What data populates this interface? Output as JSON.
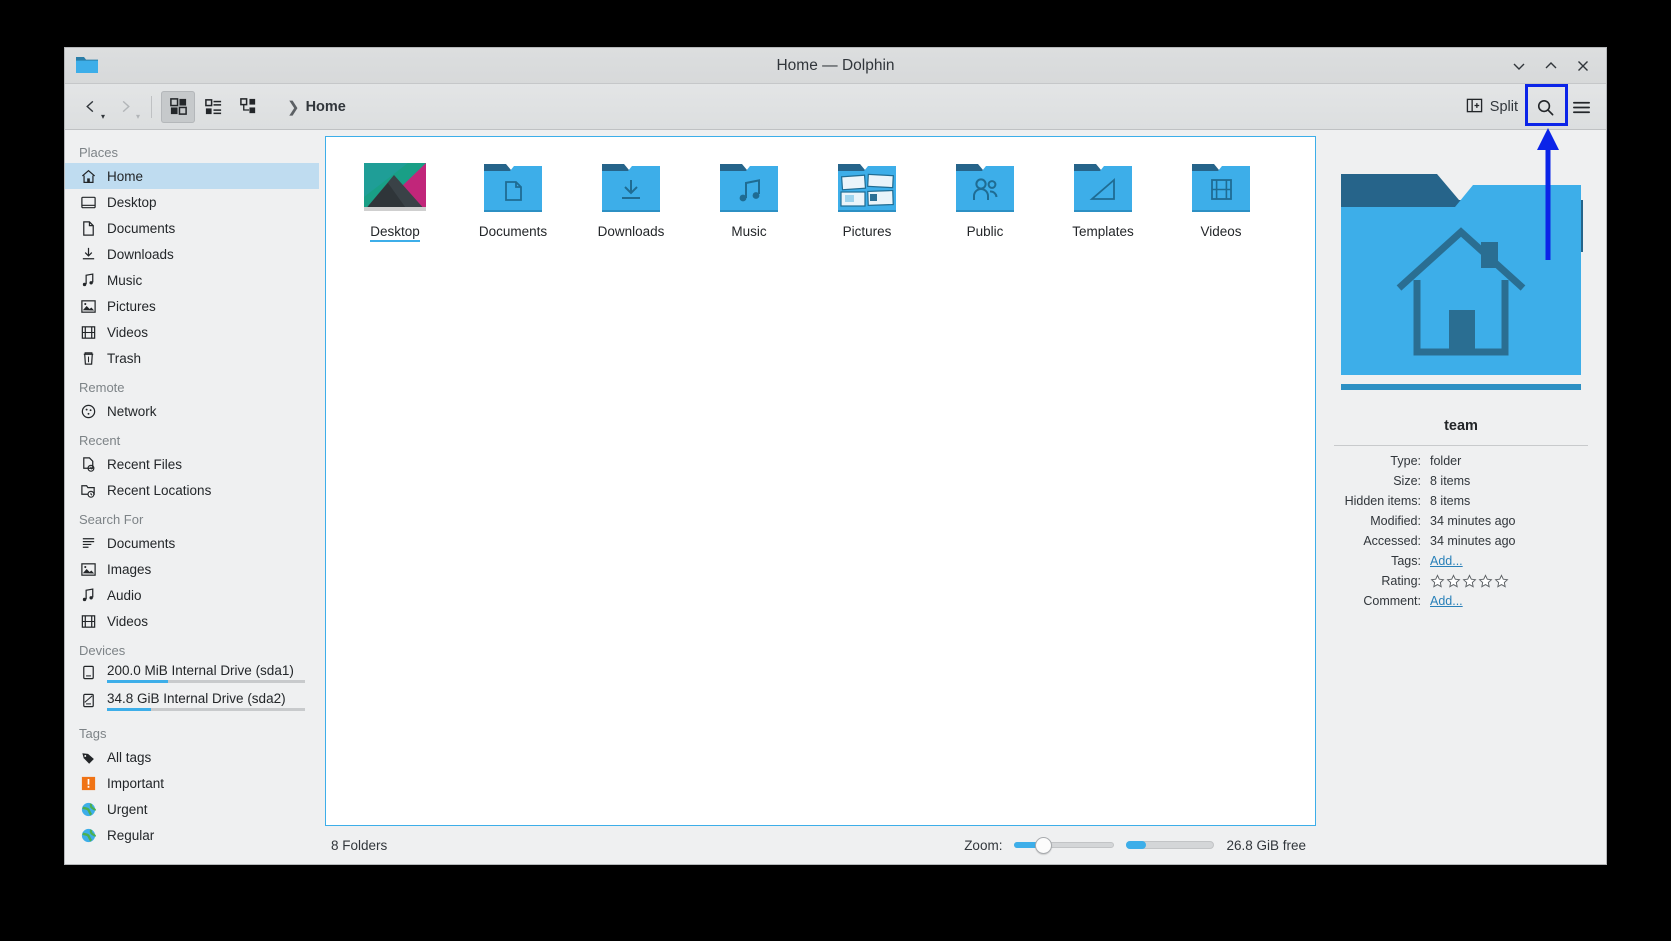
{
  "window": {
    "title": "Home — Dolphin",
    "app_icon": "folder-icon"
  },
  "titlebar_buttons": [
    {
      "name": "minimize-button",
      "glyph": "minimize-icon"
    },
    {
      "name": "maximize-button",
      "glyph": "maximize-icon"
    },
    {
      "name": "close-button",
      "glyph": "close-icon"
    }
  ],
  "toolbar": {
    "back_label": "Back",
    "forward_label": "Forward",
    "view_icons_label": "Icons",
    "view_compact_label": "Compact",
    "view_details_label": "Details",
    "split_label": "Split",
    "search_label": "Search",
    "menu_label": "Control"
  },
  "breadcrumb": {
    "separator": "❯",
    "crumb": "Home"
  },
  "sidebar": {
    "groups": [
      {
        "title": "Places",
        "items": [
          {
            "label": "Home",
            "icon": "home-icon",
            "selected": true
          },
          {
            "label": "Desktop",
            "icon": "desktop-icon",
            "selected": false
          },
          {
            "label": "Documents",
            "icon": "document-icon",
            "selected": false
          },
          {
            "label": "Downloads",
            "icon": "download-icon",
            "selected": false
          },
          {
            "label": "Music",
            "icon": "music-icon",
            "selected": false
          },
          {
            "label": "Pictures",
            "icon": "picture-icon",
            "selected": false
          },
          {
            "label": "Videos",
            "icon": "video-icon",
            "selected": false
          },
          {
            "label": "Trash",
            "icon": "trash-icon",
            "selected": false
          }
        ]
      },
      {
        "title": "Remote",
        "items": [
          {
            "label": "Network",
            "icon": "network-icon",
            "selected": false
          }
        ]
      },
      {
        "title": "Recent",
        "items": [
          {
            "label": "Recent Files",
            "icon": "recent-file-icon",
            "selected": false
          },
          {
            "label": "Recent Locations",
            "icon": "recent-folder-icon",
            "selected": false
          }
        ]
      },
      {
        "title": "Search For",
        "items": [
          {
            "label": "Documents",
            "icon": "search-documents-icon",
            "selected": false
          },
          {
            "label": "Images",
            "icon": "search-images-icon",
            "selected": false
          },
          {
            "label": "Audio",
            "icon": "search-audio-icon",
            "selected": false
          },
          {
            "label": "Videos",
            "icon": "search-videos-icon",
            "selected": false
          }
        ]
      },
      {
        "title": "Devices",
        "items": [
          {
            "label": "200.0 MiB Internal Drive (sda1)",
            "icon": "drive-icon",
            "selected": false,
            "usage_percent": 31
          },
          {
            "label": "34.8 GiB Internal Drive (sda2)",
            "icon": "drive-partition-icon",
            "selected": false,
            "usage_percent": 22
          }
        ]
      },
      {
        "title": "Tags",
        "items": [
          {
            "label": "All tags",
            "icon": "tag-icon",
            "selected": false
          },
          {
            "label": "Important",
            "icon": "important-tag-icon",
            "selected": false
          },
          {
            "label": "Urgent",
            "icon": "urgent-tag-icon",
            "selected": false
          },
          {
            "label": "Regular",
            "icon": "regular-tag-icon",
            "selected": false
          }
        ]
      }
    ]
  },
  "files": [
    {
      "name": "Desktop",
      "icon": "desktop-wallpaper-thumb",
      "selected": true
    },
    {
      "name": "Documents",
      "icon": "folder-documents-icon",
      "selected": false
    },
    {
      "name": "Downloads",
      "icon": "folder-downloads-icon",
      "selected": false
    },
    {
      "name": "Music",
      "icon": "folder-music-icon",
      "selected": false
    },
    {
      "name": "Pictures",
      "icon": "folder-pictures-icon",
      "selected": false
    },
    {
      "name": "Public",
      "icon": "folder-public-icon",
      "selected": false
    },
    {
      "name": "Templates",
      "icon": "folder-templates-icon",
      "selected": false
    },
    {
      "name": "Videos",
      "icon": "folder-videos-icon",
      "selected": false
    }
  ],
  "statusbar": {
    "item_count": "8 Folders",
    "zoom_label": "Zoom:",
    "zoom_value": 28,
    "free_space_percent": 22,
    "free_space": "26.8 GiB free"
  },
  "info_panel": {
    "preview_icon": "folder-home-large-icon",
    "name": "team",
    "rows": [
      {
        "key": "Type:",
        "value": "folder",
        "link": false
      },
      {
        "key": "Size:",
        "value": "8 items",
        "link": false
      },
      {
        "key": "Hidden items:",
        "value": "8 items",
        "link": false
      },
      {
        "key": "Modified:",
        "value": "34 minutes ago",
        "link": false
      },
      {
        "key": "Accessed:",
        "value": "34 minutes ago",
        "link": false
      },
      {
        "key": "Tags:",
        "value": "Add...",
        "link": true
      },
      {
        "key": "Rating:",
        "value": "",
        "link": false,
        "stars": 5
      },
      {
        "key": "Comment:",
        "value": "Add...",
        "link": true
      }
    ]
  },
  "annotation": {
    "color": "#0b24e8",
    "target": "search-button"
  }
}
